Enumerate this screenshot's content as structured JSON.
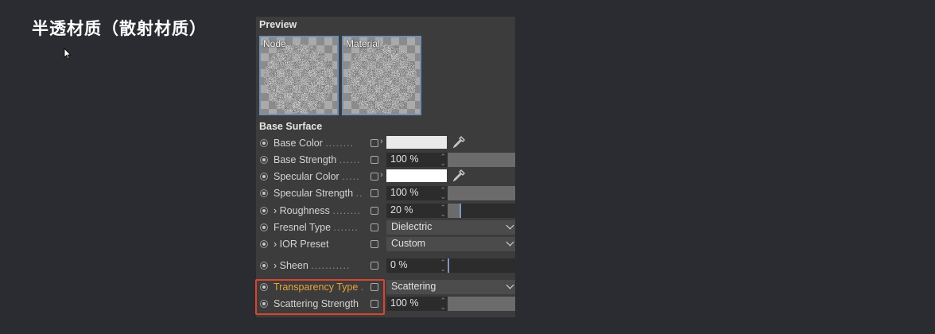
{
  "caption": "半透材质（散射材质）",
  "preview": {
    "title": "Preview",
    "thumbnails": [
      {
        "label": "Node"
      },
      {
        "label": "Material"
      }
    ]
  },
  "base_surface": {
    "title": "Base Surface",
    "rows": [
      {
        "label": "Base Color",
        "dots": "........",
        "control": "color",
        "color": "#eaeaea"
      },
      {
        "label": "Base Strength",
        "dots": "......",
        "control": "number",
        "value": "100 %",
        "fill": 1.0
      },
      {
        "label": "Specular Color",
        "dots": ".....",
        "control": "color",
        "color": "#ffffff"
      },
      {
        "label": "Specular Strength",
        "dots": "..",
        "control": "number",
        "value": "100 %",
        "fill": 1.0
      },
      {
        "label": "› Roughness",
        "dots": "........",
        "control": "number",
        "value": "20 %",
        "fill": 0.2
      },
      {
        "label": "Fresnel Type",
        "dots": ".......",
        "control": "dropdown",
        "value": "Dielectric"
      },
      {
        "label": "› IOR Preset",
        "dots": "",
        "control": "dropdown",
        "value": "Custom"
      },
      {
        "label": "› Sheen",
        "dots": "...........",
        "control": "number",
        "value": "0 %",
        "fill": 0.0
      },
      {
        "label": "Transparency Type",
        "dots": ".",
        "control": "dropdown",
        "value": "Scattering",
        "highlight": true
      },
      {
        "label": "Scattering Strength",
        "dots": "",
        "control": "number",
        "value": "100 %",
        "fill": 1.0,
        "highlight": true
      }
    ]
  },
  "colors": {
    "highlight_label": "#e8a33b",
    "highlight_box": "#d9452f",
    "slider_knob": "#7d96c2"
  }
}
